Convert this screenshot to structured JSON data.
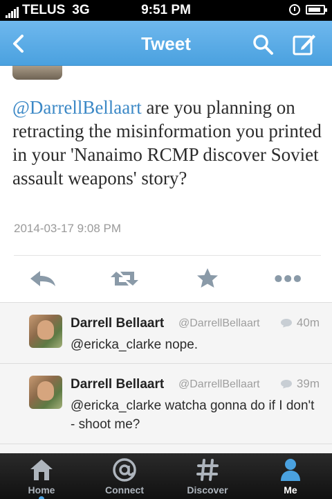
{
  "status_bar": {
    "carrier": "TELUS",
    "network": "3G",
    "time": "9:51 PM",
    "battery_level": 0.85
  },
  "nav": {
    "title": "Tweet",
    "back_icon": "chevron-left-icon",
    "search_icon": "search-icon",
    "compose_icon": "compose-icon"
  },
  "tweet": {
    "mention": "@DarrellBellaart",
    "text": " are you planning on retracting the misinformation you printed in your 'Nanaimo RCMP discover Soviet assault weapons' story?",
    "date": "2014-03-17 9:08 PM"
  },
  "actions": [
    "reply-icon",
    "retweet-icon",
    "favorite-star-icon",
    "more-icon"
  ],
  "replies": [
    {
      "name": "Darrell Bellaart",
      "handle": "@DarrellBellaart",
      "time": "40m",
      "text": "@ericka_clarke nope."
    },
    {
      "name": "Darrell Bellaart",
      "handle": "@DarrellBellaart",
      "time": "39m",
      "text": "@ericka_clarke watcha gonna do if I don't - shoot me?"
    }
  ],
  "tabs": [
    {
      "label": "Home",
      "icon": "home-icon"
    },
    {
      "label": "Connect",
      "icon": "at-icon"
    },
    {
      "label": "Discover",
      "icon": "hashtag-icon"
    },
    {
      "label": "Me",
      "icon": "person-icon",
      "active": true
    }
  ],
  "colors": {
    "accent": "#4aa1df",
    "mention": "#3b88c6",
    "tabbar": "#1a1a1a"
  }
}
